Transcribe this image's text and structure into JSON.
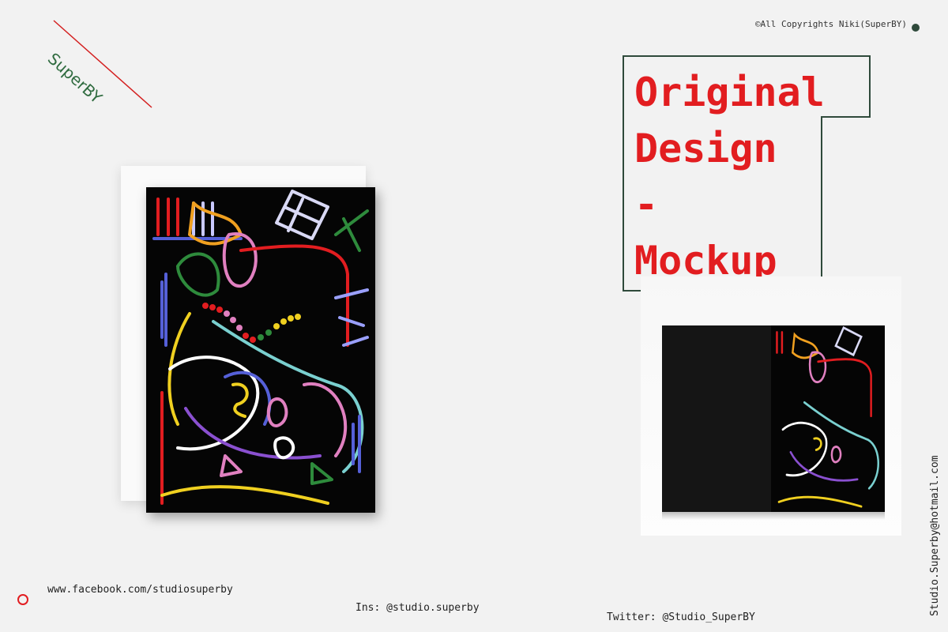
{
  "logo": {
    "text": "SuperBY",
    "line_color": "#d42020",
    "text_color": "#2f6b3f"
  },
  "copyright": "©All Copyrights Niki(SuperBY)",
  "title": {
    "lines": "Original\nDesign\n-\nMockup",
    "color": "#e21d20",
    "box_color": "#2f4a3b"
  },
  "contact": {
    "email": "Studio.Superby@hotmail.com",
    "facebook": "www.facebook.com/studiosuperby",
    "instagram": "Ins: @studio.superby",
    "twitter": "Twitter: @Studio_SuperBY"
  },
  "colors": {
    "background": "#f2f2f2",
    "card": "#050505",
    "accent": "#e21d20"
  }
}
